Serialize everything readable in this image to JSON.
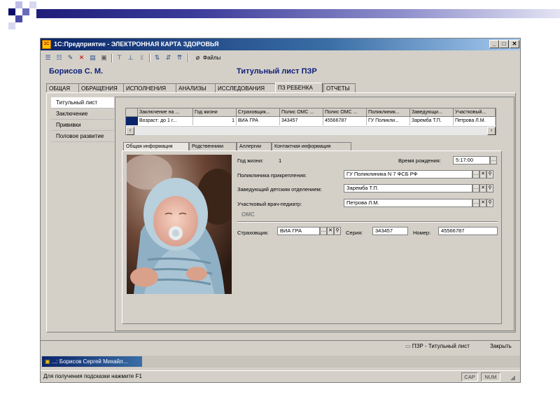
{
  "window": {
    "title": "1С:Предприятие - ЭЛЕКТРОННАЯ КАРТА ЗДОРОВЬЯ",
    "app_icon": "1С",
    "controls": {
      "minimize": "_",
      "maximize": "□",
      "close": "✕"
    }
  },
  "toolbar": {
    "files_label": "Файлы"
  },
  "header": {
    "person_name": "Борисов С. М.",
    "page_title": "Титульный лист ПЗР"
  },
  "top_tabs": [
    {
      "label": "ОБЩАЯ"
    },
    {
      "label": "ОБРАЩЕНИЯ"
    },
    {
      "label": "ИСПОЛНЕНИЯ"
    },
    {
      "label": "АНАЛИЗЫ"
    },
    {
      "label": "ИССЛЕДОВАНИЯ"
    },
    {
      "label": "ПЗ РЕБЕНКА"
    },
    {
      "label": "ОТЧЕТЫ"
    }
  ],
  "left_nav": [
    {
      "label": "Титульный лист"
    },
    {
      "label": "Заключение"
    },
    {
      "label": "Прививки"
    },
    {
      "label": "Половое развитие"
    }
  ],
  "grid": {
    "columns": [
      "Заключение на ...",
      "Год жизни",
      "Страховщик...",
      "Полис ОМС ...",
      "Полис ОМС ...",
      "Поликлиник...",
      "Заведующи...",
      "Участковый..."
    ],
    "row": [
      "Возраст: до 1 г...",
      "1",
      "ВИА ГРА",
      "343457",
      "45566787",
      "ГУ Поликли...",
      "Заремба Т.П.",
      "Петрова Л.М."
    ]
  },
  "sub_tabs": [
    {
      "label": "Общая информация"
    },
    {
      "label": "Родственники"
    },
    {
      "label": "Аллергии"
    },
    {
      "label": "Контактная информация"
    }
  ],
  "form": {
    "year_label": "Год жизни:",
    "year_value": "1",
    "birth_time_label": "Время рождения:",
    "birth_time_value": "5:17:00",
    "clinic_label": "Поликлиника прикрепления:",
    "clinic_value": "ГУ Поликлиника N 7 ФСБ РФ",
    "head_label": "Заведующий детским отделением:",
    "head_value": "Заремба Т.П.",
    "doctor_label": "Участковый врач-педиатр:",
    "doctor_value": "Петрова Л.М.",
    "oms_section": "ОМС",
    "insurer_label": "Страховщик:",
    "insurer_value": "ВИА ГРА",
    "series_label": "Серия:",
    "series_value": "343457",
    "number_label": "Номер:",
    "number_value": "45566787"
  },
  "bottom": {
    "active_form": "ПЗР - Титульный лист",
    "close_label": "Закрыть"
  },
  "taskbar": {
    "item": "...: Борисов Сергей Михайл..."
  },
  "statusbar": {
    "hint": "Для получения подсказки нажмите F1",
    "cap": "CAP",
    "num": "NUM"
  },
  "colors": {
    "title_gradient_start": "#0a246a",
    "heading_blue": "#10207a",
    "window_face": "#d4d0c8"
  }
}
